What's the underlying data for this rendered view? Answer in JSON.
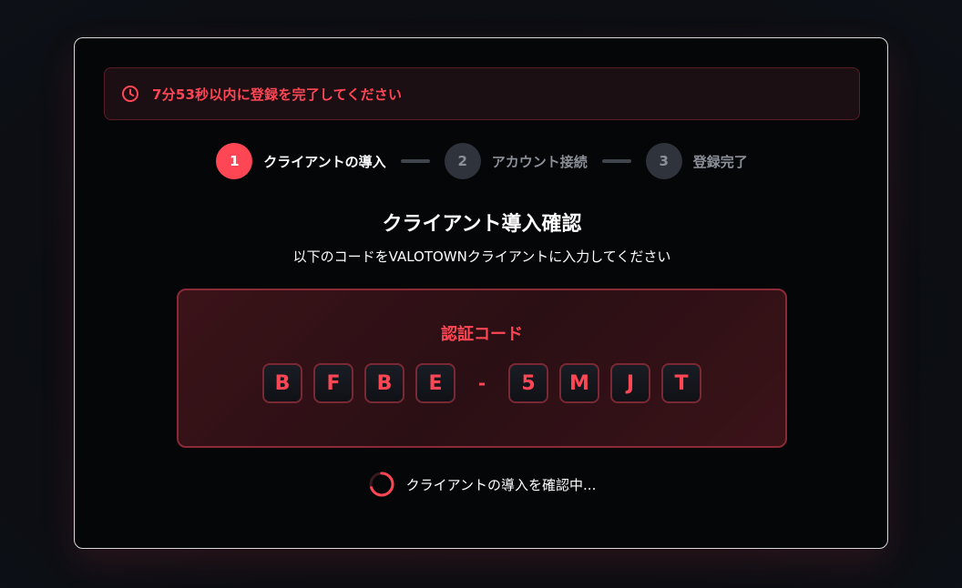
{
  "timer": {
    "message": "7分53秒以内に登録を完了してください",
    "icon": "clock-icon",
    "color": "#ff4655"
  },
  "stepper": {
    "steps": [
      {
        "number": "1",
        "label": "クライアントの導入",
        "state": "active"
      },
      {
        "number": "2",
        "label": "アカウント接続",
        "state": "inactive"
      },
      {
        "number": "3",
        "label": "登録完了",
        "state": "inactive"
      }
    ]
  },
  "main": {
    "title": "クライアント導入確認",
    "subtitle": "以下のコードをVALOTOWNクライアントに入力してください"
  },
  "code": {
    "label": "認証コード",
    "chars": [
      "B",
      "F",
      "B",
      "E",
      "-",
      "5",
      "M",
      "J",
      "T"
    ]
  },
  "status": {
    "text": "クライアントの導入を確認中...",
    "icon": "spinner-icon"
  },
  "colors": {
    "accent": "#ff4655",
    "background": "#050608",
    "border": "#d9d9dc"
  }
}
